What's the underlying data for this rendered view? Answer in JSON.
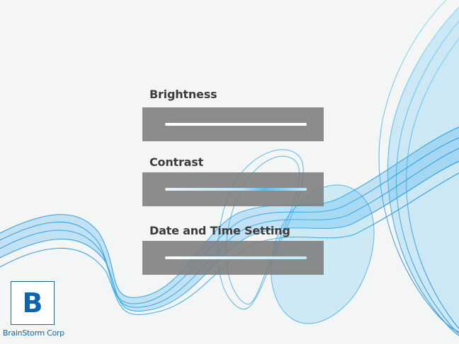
{
  "settings": [
    {
      "label": "Brightness"
    },
    {
      "label": "Contrast"
    },
    {
      "label": "Date and Time Setting"
    }
  ],
  "logo": {
    "letter": "B",
    "company": "BrainStorm Corp"
  },
  "colors": {
    "background": "#f4f6f5",
    "wave_blue": "#1a9be6",
    "panel_gray": "#7d7d7d",
    "brand_blue": "#0b66ad"
  }
}
